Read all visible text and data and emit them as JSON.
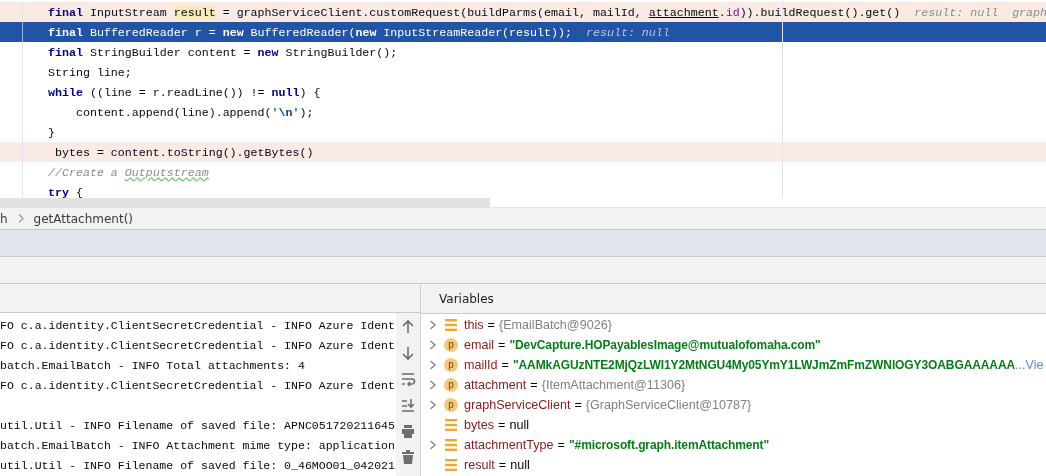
{
  "editor": {
    "lines": [
      {
        "breakpoint": true,
        "current": false,
        "tokens": [
          {
            "text": "final",
            "kind": "keyword"
          },
          {
            "text": " InputStream ",
            "kind": "plain"
          },
          {
            "text": "result",
            "kind": "marked"
          },
          {
            "text": " = graphServiceClient.customRequest(buildParms(email, mailId, ",
            "kind": "plain"
          },
          {
            "text": "attachment",
            "kind": "underlined"
          },
          {
            "text": ".",
            "kind": "plain"
          },
          {
            "text": "id",
            "kind": "field"
          },
          {
            "text": ")).buildRequest().get()",
            "kind": "plain"
          },
          {
            "text": "result: null",
            "kind": "hint"
          },
          {
            "text": "graph",
            "kind": "hint"
          }
        ]
      },
      {
        "breakpoint": false,
        "current": true,
        "tokens": [
          {
            "text": "final",
            "kind": "keyword"
          },
          {
            "text": " BufferedReader r = ",
            "kind": "plain"
          },
          {
            "text": "new",
            "kind": "keyword"
          },
          {
            "text": " BufferedReader(",
            "kind": "plain"
          },
          {
            "text": "new",
            "kind": "keyword"
          },
          {
            "text": " InputStreamReader(result));",
            "kind": "plain"
          },
          {
            "text": "result: null",
            "kind": "hint"
          }
        ]
      },
      {
        "breakpoint": false,
        "current": false,
        "tokens": [
          {
            "text": "final",
            "kind": "keyword"
          },
          {
            "text": " StringBuilder content = ",
            "kind": "plain"
          },
          {
            "text": "new",
            "kind": "keyword"
          },
          {
            "text": " StringBuilder();",
            "kind": "plain"
          }
        ]
      },
      {
        "breakpoint": false,
        "current": false,
        "tokens": [
          {
            "text": "String line;",
            "kind": "plain"
          }
        ]
      },
      {
        "breakpoint": false,
        "current": false,
        "tokens": [
          {
            "text": "while",
            "kind": "keyword"
          },
          {
            "text": " ((line = r.readLine()) != ",
            "kind": "plain"
          },
          {
            "text": "null",
            "kind": "keyword"
          },
          {
            "text": ") {",
            "kind": "plain"
          }
        ]
      },
      {
        "breakpoint": false,
        "current": false,
        "tokens": [
          {
            "text": "    content.append(line).append(",
            "kind": "plain"
          },
          {
            "text": "'",
            "kind": "string"
          },
          {
            "text": "\\n",
            "kind": "escape"
          },
          {
            "text": "'",
            "kind": "string"
          },
          {
            "text": ");",
            "kind": "plain"
          }
        ]
      },
      {
        "breakpoint": false,
        "current": false,
        "tokens": [
          {
            "text": "}",
            "kind": "plain"
          }
        ]
      },
      {
        "breakpoint": true,
        "current": false,
        "tokens": [
          {
            "text": " bytes = content.toString().getBytes()",
            "kind": "plain"
          }
        ]
      },
      {
        "breakpoint": false,
        "current": false,
        "tokens": [
          {
            "text": "//Create a ",
            "kind": "comment"
          },
          {
            "text": "Outputstream",
            "kind": "typo"
          }
        ]
      },
      {
        "breakpoint": false,
        "current": false,
        "tokens": [
          {
            "text": "try",
            "kind": "keyword"
          },
          {
            "text": " {",
            "kind": "plain"
          }
        ]
      }
    ]
  },
  "breadcrumbs": [
    "h",
    "getAttachment()"
  ],
  "console": {
    "lines": [
      {
        "kind": "output",
        "text": "FO c.a.identity.ClientSecretCredential - INFO Azure Ident"
      },
      {
        "kind": "output",
        "text": "FO c.a.identity.ClientSecretCredential - INFO Azure Ident"
      },
      {
        "kind": "output",
        "text": "batch.EmailBatch - INFO Total attachments: 4"
      },
      {
        "kind": "output",
        "text": "FO c.a.identity.ClientSecretCredential - INFO Azure Ident"
      },
      {
        "kind": "blank"
      },
      {
        "kind": "output",
        "text": "util.Util - INFO Filename of saved file: APNC051720211645"
      },
      {
        "kind": "output",
        "text": "batch.EmailBatch - INFO Attachment mime type: application"
      },
      {
        "kind": "output",
        "text": "util.Util - INFO Filename of saved file: 0_46MOO01_042021"
      }
    ]
  },
  "variables": {
    "title": "Variables",
    "rows": [
      {
        "name": "this",
        "kind": "field",
        "expandable": true,
        "separator": "=",
        "value": [
          {
            "text": "{EmailBatch@9026}",
            "kind": "object"
          }
        ]
      },
      {
        "name": "email",
        "kind": "param",
        "badge": "p",
        "expandable": true,
        "separator": "=",
        "value": [
          {
            "text": "\"DevCapture.HOPayablesImage@mutualofomaha.com\"",
            "kind": "string"
          }
        ]
      },
      {
        "name": "mailId",
        "kind": "param",
        "badge": "p",
        "expandable": true,
        "separator": "=",
        "value": [
          {
            "text": "\"AAMkAGUzNTE2MjQzLWI1Y2MtNGU4My05YmY1LWJmZmFmZWNlOGY3OABGAAAAAA",
            "kind": "string"
          },
          {
            "text": "...",
            "kind": "ellipsis"
          },
          {
            "text": "Vie",
            "kind": "link"
          }
        ]
      },
      {
        "name": "attachment",
        "kind": "param",
        "badge": "p",
        "expandable": true,
        "separator": "=",
        "value": [
          {
            "text": "{ItemAttachment@11306}",
            "kind": "object"
          }
        ]
      },
      {
        "name": "graphServiceClient",
        "kind": "param",
        "badge": "p",
        "expandable": true,
        "separator": "=",
        "value": [
          {
            "text": "{GraphServiceClient@10787}",
            "kind": "object"
          }
        ]
      },
      {
        "name": "bytes",
        "kind": "field",
        "expandable": false,
        "separator": "=",
        "value": [
          {
            "text": "null",
            "kind": "null"
          }
        ]
      },
      {
        "name": "attachmentType",
        "kind": "field",
        "expandable": true,
        "separator": "=",
        "value": [
          {
            "text": "\"#microsoft.graph.itemAttachment\"",
            "kind": "string"
          }
        ]
      },
      {
        "name": "result",
        "kind": "field",
        "expandable": false,
        "separator": "=",
        "value": [
          {
            "text": "null",
            "kind": "null"
          }
        ]
      }
    ]
  }
}
